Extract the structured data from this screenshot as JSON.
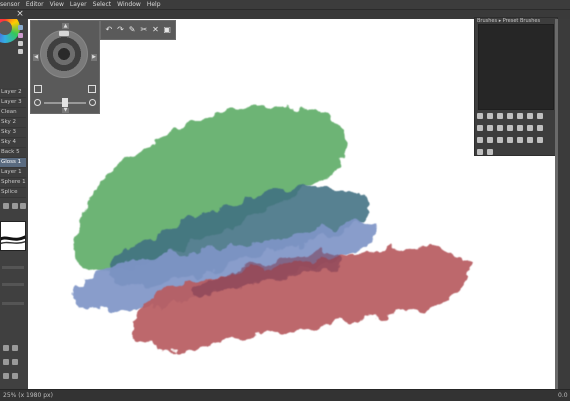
{
  "menubar": {
    "items": [
      "sensor",
      "Editor",
      "View",
      "Layer",
      "Select",
      "Window",
      "Help"
    ]
  },
  "left_panel": {
    "layers": [
      "Layer 2",
      "Layer 3",
      "Clean",
      "Sky 2",
      "Sky 3",
      "Sky 4",
      "Back 5",
      "Gloss 1",
      "Layer 1",
      "Sphere 1",
      "Splice"
    ]
  },
  "toolbar": {
    "icons": [
      "undo-icon",
      "redo-icon",
      "pen-icon",
      "cut-icon",
      "close-icon",
      "image-icon"
    ]
  },
  "status": {
    "left_text": "25% (x 1980 px)",
    "right_text": "0.0"
  },
  "right_panel": {
    "title": "Brushes ▸ Preset Brushes"
  },
  "colors": {
    "green": "#66b06e",
    "blue": "#7f95c7",
    "teal": "#3f6f82",
    "red": "#b85c61"
  }
}
